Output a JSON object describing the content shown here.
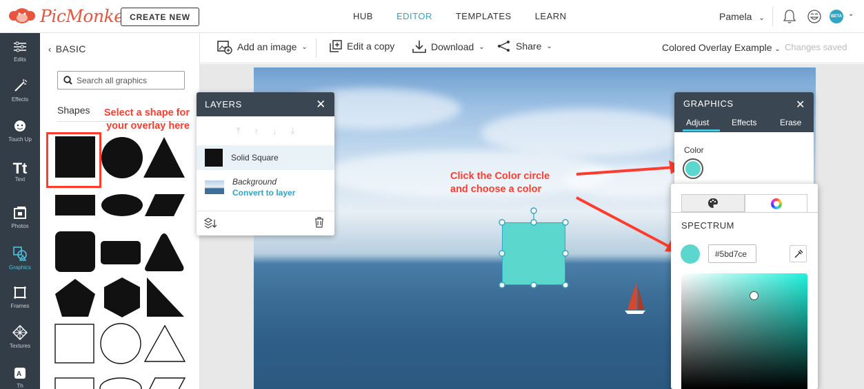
{
  "brand": {
    "name": "PicMonkey"
  },
  "topnav": {
    "create_new": "CREATE NEW",
    "links": [
      "HUB",
      "EDITOR",
      "TEMPLATES",
      "LEARN"
    ],
    "active_link": "EDITOR",
    "user_name": "Pamela",
    "beta_badge": "BETA"
  },
  "rail": {
    "items": [
      {
        "label": "Edits",
        "icon": "sliders-icon"
      },
      {
        "label": "Effects",
        "icon": "magic-wand-icon"
      },
      {
        "label": "Touch Up",
        "icon": "face-icon"
      },
      {
        "label": "Text",
        "icon": "text-icon"
      },
      {
        "label": "Photos",
        "icon": "photos-icon"
      },
      {
        "label": "Graphics",
        "icon": "graphics-icon"
      },
      {
        "label": "Frames",
        "icon": "frames-icon"
      },
      {
        "label": "Textures",
        "icon": "textures-icon"
      },
      {
        "label": "Th",
        "icon": "themes-icon"
      }
    ],
    "active": "Graphics"
  },
  "left_panel": {
    "back_label": "BASIC",
    "search_placeholder": "Search all graphics",
    "section_label": "Shapes"
  },
  "annotations": {
    "shape_tip_line1": "Select a shape for",
    "shape_tip_line2": "your overlay here",
    "color_tip_line1": "Click the Color circle",
    "color_tip_line2": "and choose a color"
  },
  "toolbar": {
    "add_image": "Add an image",
    "edit_copy": "Edit a copy",
    "download": "Download",
    "share": "Share",
    "doc_title": "Colored Overlay Example",
    "save_status": "Changes saved"
  },
  "layers": {
    "title": "LAYERS",
    "items": [
      {
        "name": "Solid Square"
      },
      {
        "name": "Background",
        "action": "Convert to layer"
      }
    ]
  },
  "graphics_panel": {
    "title": "GRAPHICS",
    "tabs": [
      "Adjust",
      "Effects",
      "Erase"
    ],
    "active_tab": "Adjust",
    "color_label": "Color",
    "color_value": "#5bd7ce"
  },
  "color_picker": {
    "section_title": "SPECTRUM",
    "hex_value": "#5bd7ce"
  },
  "colors": {
    "accent": "#2fa4c4",
    "overlay": "#5bd7ce",
    "annotation": "#ff3b2e",
    "panel_header": "#3a4753",
    "rail": "#333d47"
  }
}
